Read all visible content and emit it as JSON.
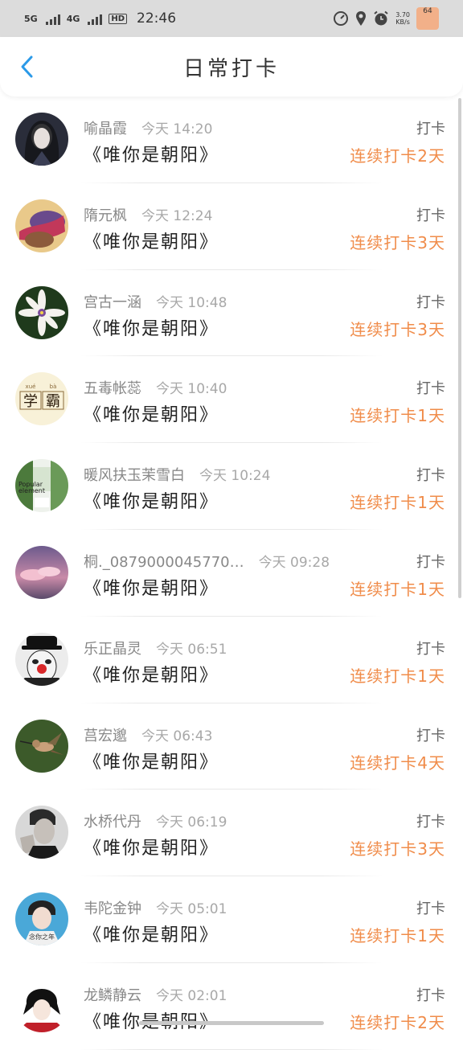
{
  "status_bar": {
    "net1": "5G",
    "net2": "4G",
    "hd": "HD",
    "time": "22:46",
    "speed_top": "3.70",
    "speed_bottom": "KB/s",
    "battery": "64"
  },
  "header": {
    "title": "日常打卡",
    "back_icon": "chevron-left-icon",
    "accent": "#2b9ae8"
  },
  "colors": {
    "streak": "#f08c4a",
    "name": "#888888"
  },
  "entries": [
    {
      "name": "喻晶霞",
      "time": "今天 14:20",
      "book": "《唯你是朝阳》",
      "action": "打卡",
      "streak": "连续打卡2天",
      "avatar": "avatar-dark-girl"
    },
    {
      "name": "隋元枫",
      "time": "今天 12:24",
      "book": "《唯你是朝阳》",
      "action": "打卡",
      "streak": "连续打卡3天",
      "avatar": "avatar-game-character"
    },
    {
      "name": "宫古一涵",
      "time": "今天 10:48",
      "book": "《唯你是朝阳》",
      "action": "打卡",
      "streak": "连续打卡3天",
      "avatar": "avatar-white-flower"
    },
    {
      "name": "五毒帐蕊",
      "time": "今天 10:40",
      "book": "《唯你是朝阳》",
      "action": "打卡",
      "streak": "连续打卡1天",
      "avatar": "avatar-xueba-text",
      "avatar_text": [
        "学",
        "霸"
      ],
      "avatar_pinyin": [
        "xué",
        "bà"
      ]
    },
    {
      "name": "暖风扶玉茉雪白",
      "time": "今天 10:24",
      "book": "《唯你是朝阳》",
      "action": "打卡",
      "streak": "连续打卡1天",
      "avatar": "avatar-popular-element",
      "avatar_text": [
        "Popular",
        "element"
      ]
    },
    {
      "name": "桐._0879000045770…",
      "time": "今天 09:28",
      "book": "《唯你是朝阳》",
      "action": "打卡",
      "streak": "连续打卡1天",
      "avatar": "avatar-pink-clouds"
    },
    {
      "name": "乐正晶灵",
      "time": "今天 06:51",
      "book": "《唯你是朝阳》",
      "action": "打卡",
      "streak": "连续打卡1天",
      "avatar": "avatar-clown"
    },
    {
      "name": "莒宏邈",
      "time": "今天 06:43",
      "book": "《唯你是朝阳》",
      "action": "打卡",
      "streak": "连续打卡4天",
      "avatar": "avatar-hummingbird"
    },
    {
      "name": "水桥代丹",
      "time": "今天 06:19",
      "book": "《唯你是朝阳》",
      "action": "打卡",
      "streak": "连续打卡3天",
      "avatar": "avatar-man-portrait"
    },
    {
      "name": "韦陀金钟",
      "time": "今天 05:01",
      "book": "《唯你是朝阳》",
      "action": "打卡",
      "streak": "连续打卡1天",
      "avatar": "avatar-boy-photo",
      "avatar_text": [
        "念你之年"
      ]
    },
    {
      "name": "龙鳞静云",
      "time": "今天 02:01",
      "book": "《唯你是朝阳》",
      "action": "打卡",
      "streak": "连续打卡2天",
      "avatar": "avatar-anime-boy"
    }
  ]
}
